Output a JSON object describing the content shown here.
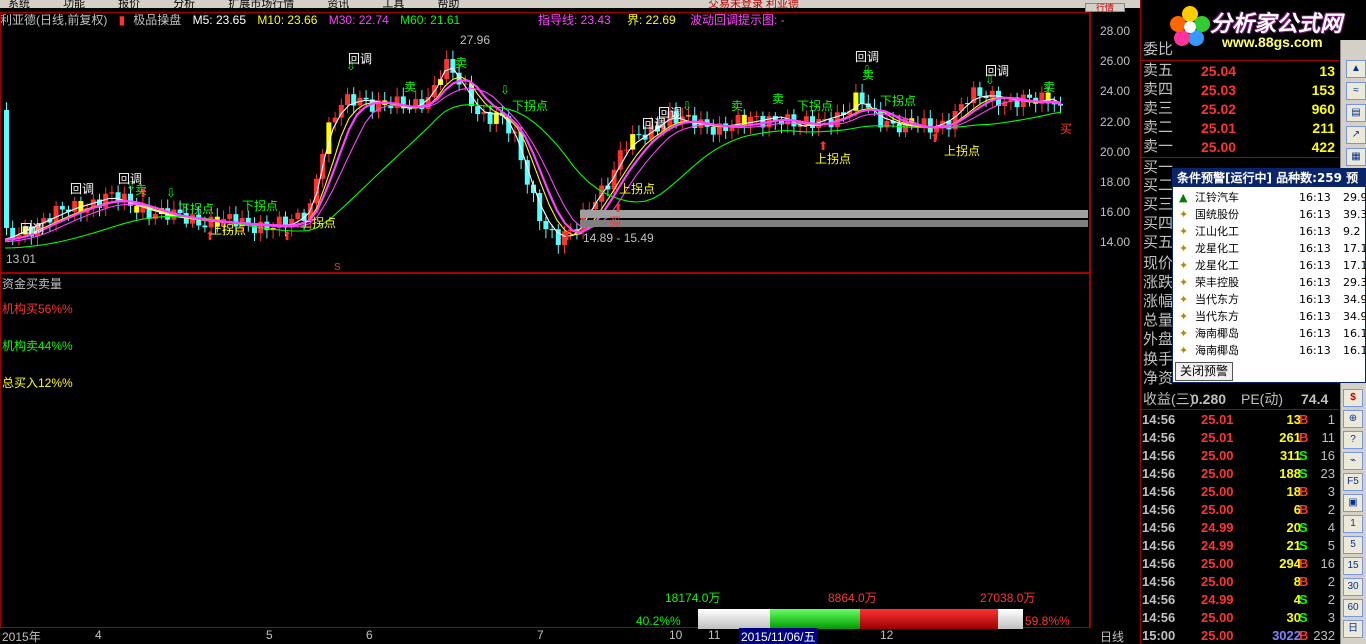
{
  "menu": {
    "items": [
      "系统",
      "功能",
      "报价",
      "分析",
      "扩展市场行情",
      "资讯",
      "工具",
      "帮助"
    ],
    "window_title": "交易未登录 利亚德"
  },
  "top_buttons": {
    "trade": "行情",
    "info": "资"
  },
  "infoline": {
    "stock": "利亚德(日线,前复权)",
    "indicator": "极品操盘",
    "m5": "M5: 23.65",
    "m10": "M10: 23.66",
    "m30": "M30: 22.74",
    "m60": "M60: 21.61",
    "guide": "指导线: 23.43",
    "bound": "界: 22.69",
    "wave": "波动回调提示图: -"
  },
  "price_axis": [
    "28.00",
    "26.00",
    "24.00",
    "22.00",
    "20.00",
    "18.00",
    "16.00",
    "14.00"
  ],
  "chart_text": {
    "high": "27.96",
    "low": "13.01",
    "range": "14.89 - 15.49",
    "hl": "下拐点",
    "up": "上拐点",
    "callback": "回调",
    "sell": "卖",
    "buy": "买",
    "s_marker": "S"
  },
  "sub_panel": {
    "title": "资金买卖量",
    "inst_buy": "机构买56%%",
    "inst_sell": "机构卖44%%",
    "total_buy": "总买入12%%"
  },
  "bottom_bar": {
    "v1": "18174.0万",
    "v2": "8864.0万",
    "v3": "27038.0万",
    "pct_left": "40.2%%",
    "pct_right": "59.8%%"
  },
  "x_axis": {
    "year": "2015年",
    "m4": "4",
    "m5": "5",
    "m6": "6",
    "m7": "7",
    "m10": "10",
    "m11": "11",
    "date": "2015/11/06/五",
    "m12": "12",
    "period": "日线"
  },
  "logo": {
    "title": "分析家公式网",
    "url": "www.88gs.com"
  },
  "order_book": {
    "header": "委比",
    "sell": [
      {
        "label": "卖五",
        "price": "25.04",
        "vol": "13"
      },
      {
        "label": "卖四",
        "price": "25.03",
        "vol": "153"
      },
      {
        "label": "卖三",
        "price": "25.02",
        "vol": "960"
      },
      {
        "label": "卖二",
        "price": "25.01",
        "vol": "211"
      },
      {
        "label": "卖一",
        "price": "25.00",
        "vol": "422"
      }
    ],
    "buy_labels": [
      "买一",
      "买二",
      "买三",
      "买四",
      "买五"
    ],
    "stats": [
      "现价",
      "涨跌",
      "涨幅",
      "总量",
      "外盘",
      "换手",
      "净资"
    ],
    "earn_label": "收益(三)",
    "earn_val": "0.280",
    "pe_label": "PE(动)",
    "pe_val": "74.4"
  },
  "ticks": [
    {
      "t": "14:56",
      "p": "25.01",
      "v": "13",
      "bs": "B",
      "n": "1"
    },
    {
      "t": "14:56",
      "p": "25.01",
      "v": "261",
      "bs": "B",
      "n": "11"
    },
    {
      "t": "14:56",
      "p": "25.00",
      "v": "311",
      "bs": "S",
      "n": "16"
    },
    {
      "t": "14:56",
      "p": "25.00",
      "v": "188",
      "bs": "S",
      "n": "23"
    },
    {
      "t": "14:56",
      "p": "25.00",
      "v": "18",
      "bs": "B",
      "n": "3"
    },
    {
      "t": "14:56",
      "p": "25.00",
      "v": "6",
      "bs": "B",
      "n": "2"
    },
    {
      "t": "14:56",
      "p": "24.99",
      "v": "20",
      "bs": "S",
      "n": "4"
    },
    {
      "t": "14:56",
      "p": "24.99",
      "v": "21",
      "bs": "S",
      "n": "5"
    },
    {
      "t": "14:56",
      "p": "25.00",
      "v": "294",
      "bs": "B",
      "n": "16"
    },
    {
      "t": "14:56",
      "p": "25.00",
      "v": "8",
      "bs": "B",
      "n": "2"
    },
    {
      "t": "14:56",
      "p": "24.99",
      "v": "4",
      "bs": "S",
      "n": "2"
    },
    {
      "t": "14:56",
      "p": "25.00",
      "v": "30",
      "bs": "S",
      "n": "3"
    },
    {
      "t": "15:00",
      "p": "25.00",
      "v": "3022",
      "bs": "B",
      "n": "232"
    }
  ],
  "alert": {
    "title": "条件预警[运行中] 品种数:259 预",
    "rows": [
      {
        "name": "江铃汽车",
        "time": "16:13",
        "pct": "29.9"
      },
      {
        "name": "国统股份",
        "time": "16:13",
        "pct": "39.3"
      },
      {
        "name": "江山化工",
        "time": "16:13",
        "pct": "9.2"
      },
      {
        "name": "龙星化工",
        "time": "16:13",
        "pct": "17.1"
      },
      {
        "name": "龙星化工",
        "time": "16:13",
        "pct": "17.1"
      },
      {
        "name": "荣丰控股",
        "time": "16:13",
        "pct": "29.3"
      },
      {
        "name": "当代东方",
        "time": "16:13",
        "pct": "34.9"
      },
      {
        "name": "当代东方",
        "time": "16:13",
        "pct": "34.9"
      },
      {
        "name": "海南椰岛",
        "time": "16:13",
        "pct": "16.1"
      },
      {
        "name": "海南椰岛",
        "time": "16:13",
        "pct": "16.1"
      }
    ],
    "close": "关闭预警"
  },
  "sidebar_icons": [
    "$",
    "⊕",
    "?",
    "⌁",
    "F5",
    "▣",
    "1",
    "5",
    "15",
    "30",
    "60",
    "日"
  ],
  "colors": {
    "up": "#ff3232",
    "down": "#54ffff",
    "yellow": "#ffff00",
    "green": "#00ff00",
    "magenta": "#ff40ff",
    "frame": "#a00000"
  }
}
